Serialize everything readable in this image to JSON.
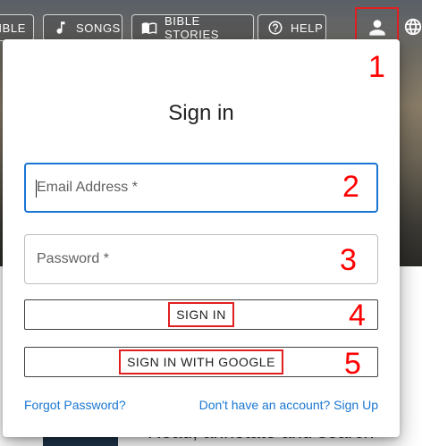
{
  "nav": {
    "bible_label": "IBLE",
    "songs_label": "SONGS",
    "stories_label": "BIBLE STORIES",
    "help_label": "HELP"
  },
  "background": {
    "headline": "Read, annotate and search"
  },
  "dialog": {
    "title": "Sign in",
    "email_label": "Email Address *",
    "password_label": "Password *",
    "signin_label": "SIGN IN",
    "google_label": "SIGN IN WITH GOOGLE",
    "forgot_label": "Forgot Password?",
    "signup_label": "Don't have an account? Sign Up"
  },
  "annotations": {
    "b1": "1",
    "b2": "2",
    "b3": "3",
    "b4": "4",
    "b5": "5"
  },
  "colors": {
    "accent": "#1976d2",
    "annotation": "#ff0000",
    "highlight_box": "#e02020"
  }
}
